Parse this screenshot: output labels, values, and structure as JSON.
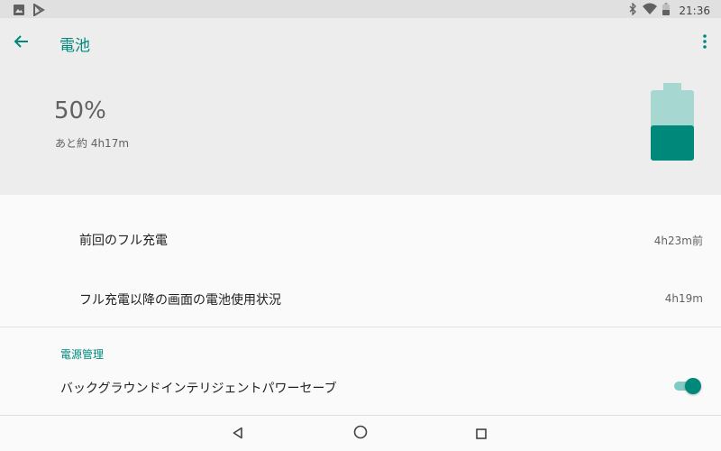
{
  "status_bar": {
    "left_icons": [
      "image-icon",
      "play-store-icon"
    ],
    "right_icons": [
      "bluetooth-icon",
      "wifi-icon",
      "battery-status-icon"
    ],
    "time": "21:36"
  },
  "app_bar": {
    "title": "電池",
    "back_icon": "arrow-back-icon",
    "menu_icon": "more-vert-icon"
  },
  "battery": {
    "percent_text": "50%",
    "remaining": "あと約 4h17m",
    "level": 0.5,
    "colors": {
      "fill": "#00897b",
      "empty": "#a7d7d1",
      "accent": "#00897b"
    }
  },
  "stats": [
    {
      "label": "前回のフル充電",
      "value": "4h23m前"
    },
    {
      "label": "フル充電以降の画面の電池使用状況",
      "value": "4h19m"
    }
  ],
  "power_management": {
    "section_title": "電源管理",
    "toggle_label": "バックグラウンドインテリジェントパワーセーブ",
    "toggle_on": true
  },
  "nav_bar": {
    "buttons": [
      "back-triangle-icon",
      "home-circle-icon",
      "recents-square-icon"
    ]
  }
}
